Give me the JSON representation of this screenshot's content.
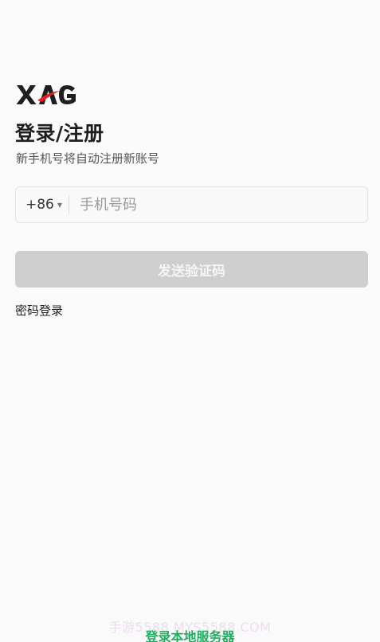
{
  "logo": {
    "text": "XAG",
    "colors": {
      "dark": "#1f1f1f",
      "accent": "#e02222"
    }
  },
  "header": {
    "title": "登录/注册",
    "subtitle": "新手机号将自动注册新账号"
  },
  "phone": {
    "country_code": "+86",
    "caret_icon": "caret-down-icon",
    "placeholder": "手机号码",
    "value": ""
  },
  "send_button": {
    "label": "发送验证码",
    "enabled": false
  },
  "password_login": {
    "label": "密码登录"
  },
  "watermark": {
    "text": "手游5588  MYS5588.COM"
  },
  "footer": {
    "local_login_label": "登录本地服务器"
  },
  "colors": {
    "background": "#fafafa",
    "button_disabled": "#cecece",
    "link_green": "#1fae5f"
  }
}
